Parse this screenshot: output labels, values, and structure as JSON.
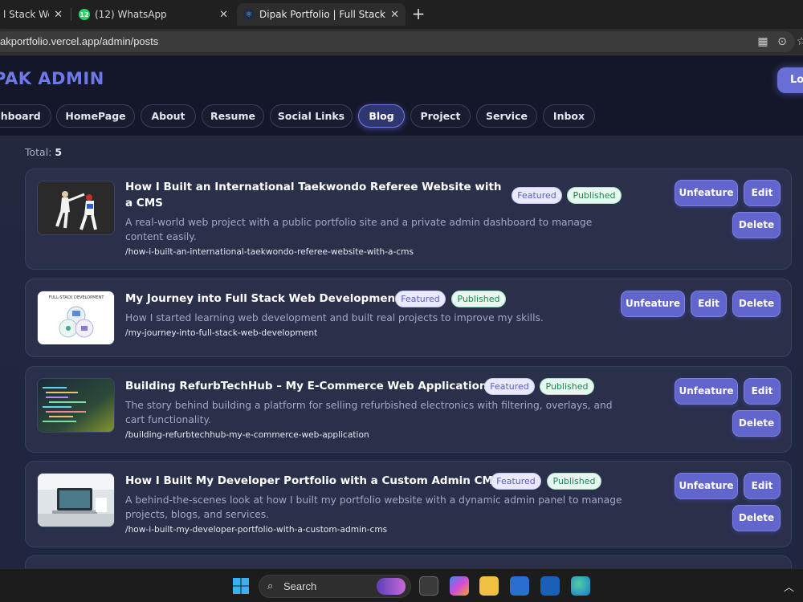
{
  "browser": {
    "tabs": [
      {
        "title": "l Stack Web De",
        "active": false
      },
      {
        "title": "(12) WhatsApp",
        "badge": "12",
        "active": false
      },
      {
        "title": "Dipak Portfolio | Full Stack Develop",
        "active": true
      }
    ],
    "url": "akportfolio.vercel.app/admin/posts"
  },
  "header": {
    "brand": "PAK ADMIN",
    "logout_label": "Lo",
    "nav": [
      "shboard",
      "HomePage",
      "About",
      "Resume",
      "Social Links",
      "Blog",
      "Project",
      "Service",
      "Inbox"
    ],
    "active_nav": "Blog"
  },
  "content": {
    "total_label": "Total:",
    "total_count": "5",
    "posts": [
      {
        "title": "How I Built an International Taekwondo Referee Website with a CMS",
        "description": "A real-world web project with a public portfolio site and a private admin dashboard to manage content easily.",
        "slug": "/how-i-built-an-international-taekwondo-referee-website-with-a-cms",
        "featured_label": "Featured",
        "status_label": "Published",
        "unfeature_label": "Unfeature",
        "edit_label": "Edit",
        "delete_label": "Delete"
      },
      {
        "title": "My Journey into Full Stack Web Development",
        "description": "How I started learning web development and built real projects to improve my skills.",
        "slug": "/my-journey-into-full-stack-web-development",
        "featured_label": "Featured",
        "status_label": "Published",
        "unfeature_label": "Unfeature",
        "edit_label": "Edit",
        "delete_label": "Delete",
        "thumb_text": "FULL-STACK DEVELOPMENT"
      },
      {
        "title": "Building RefurbTechHub – My E-Commerce Web Application",
        "description": "The story behind building a platform for selling refurbished electronics with filtering, overlays, and cart functionality.",
        "slug": "/building-refurbtechhub-my-e-commerce-web-application",
        "featured_label": "Featured",
        "status_label": "Published",
        "unfeature_label": "Unfeature",
        "edit_label": "Edit",
        "delete_label": "Delete"
      },
      {
        "title": "How I Built My Developer Portfolio with a Custom Admin CMS",
        "description": "A behind-the-scenes look at how I built my portfolio website with a dynamic admin panel to manage projects, blogs, and services.",
        "slug": "/how-i-built-my-developer-portfolio-with-a-custom-admin-cms",
        "featured_label": "Featured",
        "status_label": "Published",
        "unfeature_label": "Unfeature",
        "edit_label": "Edit",
        "delete_label": "Delete"
      }
    ]
  },
  "taskbar": {
    "search_label": "Search"
  },
  "colors": {
    "accent": "#6165cc",
    "brand": "#6f78e8",
    "published": "#17884f",
    "featured": "#5860c7"
  }
}
